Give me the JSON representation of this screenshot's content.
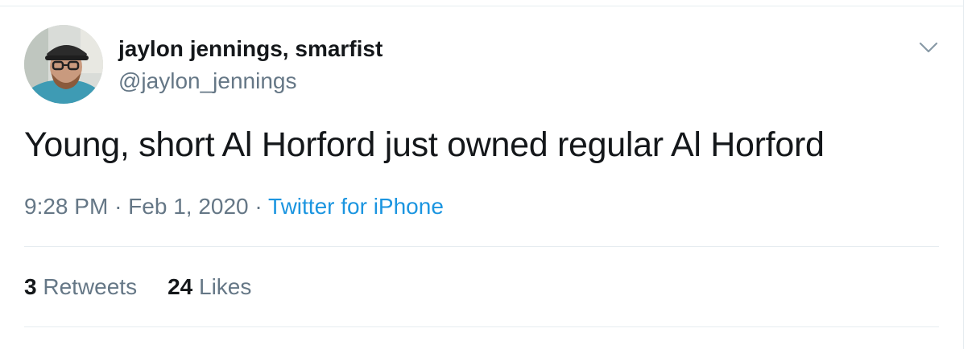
{
  "tweet": {
    "author": {
      "display_name": "jaylon jennings, smarfist",
      "handle": "@jaylon_jennings"
    },
    "text": "Young, short Al Horford just owned regular Al Horford",
    "time": "9:28 PM",
    "separator": "·",
    "date": "Feb 1, 2020",
    "source": "Twitter for iPhone",
    "stats": {
      "retweets_count": "3",
      "retweets_label": "Retweets",
      "likes_count": "24",
      "likes_label": "Likes"
    }
  },
  "icons": {
    "menu": "chevron-down-icon"
  },
  "colors": {
    "text_primary": "#14171a",
    "text_secondary": "#657786",
    "link": "#1b95e0",
    "divider": "#e6ecf0"
  }
}
